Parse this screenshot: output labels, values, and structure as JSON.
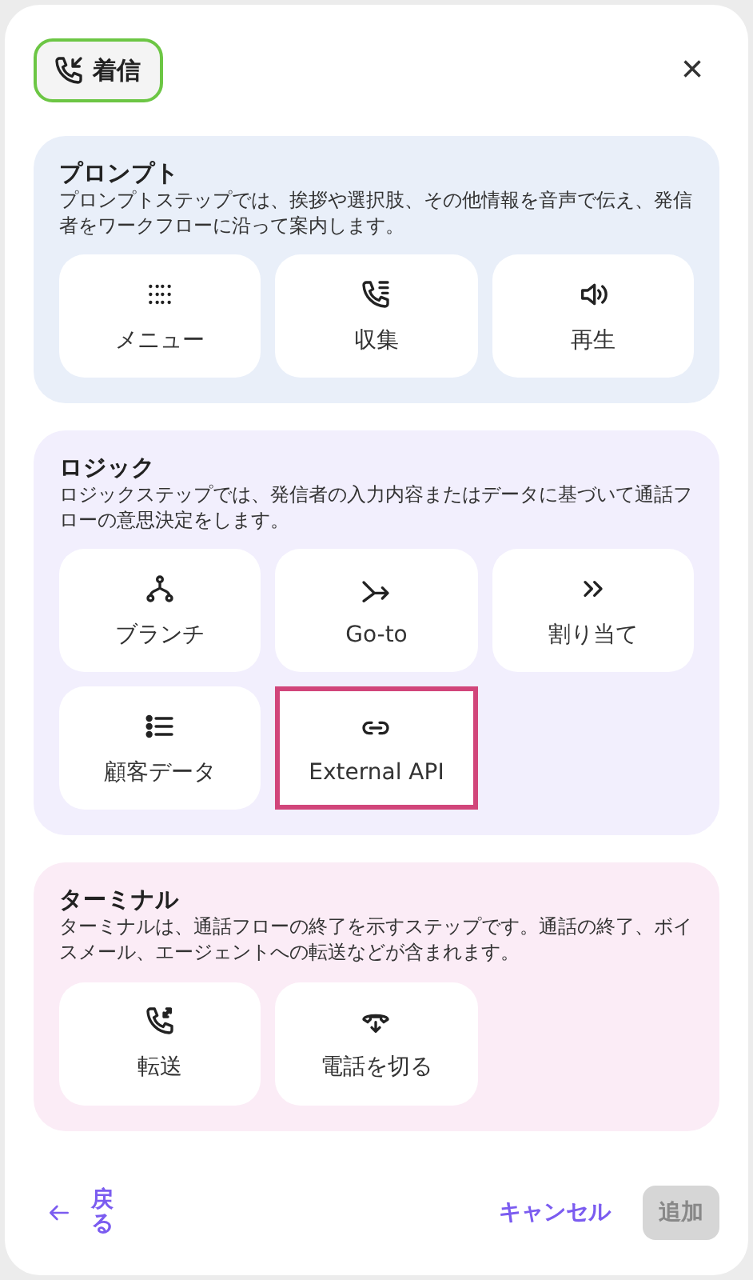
{
  "header": {
    "chip": {
      "label": "着信",
      "selected": true
    },
    "close": "×"
  },
  "sections": [
    {
      "title": "プロンプト",
      "description": "プロンプトステップでは、挨拶や選択肢、その他情報を音声で伝え、発信者をワークフローに沿って案内します。",
      "color": "#e9eff9",
      "tiles": [
        {
          "label": "メニュー",
          "selected": false
        },
        {
          "label": "収集",
          "selected": false
        },
        {
          "label": "再生",
          "selected": false
        }
      ]
    },
    {
      "title": "ロジック",
      "description": "ロジックステップでは、発信者の入力内容またはデータに基づいて通話フローの意思決定をします。",
      "color": "#f2effd",
      "tiles": [
        {
          "label": "ブランチ",
          "selected": false
        },
        {
          "label": "Go-to",
          "selected": false
        },
        {
          "label": "割り当て",
          "selected": false
        },
        {
          "label": "顧客データ",
          "selected": false
        },
        {
          "label": "External API",
          "selected": true
        }
      ]
    },
    {
      "title": "ターミナル",
      "description": "ターミナルは、通話フローの終了を示すステップです。通話の終了、ボイスメール、エージェントへの転送などが含まれます。",
      "color": "#fbecf6",
      "tiles": [
        {
          "label": "転送",
          "selected": false
        },
        {
          "label": "電話を切る",
          "selected": false
        }
      ]
    }
  ],
  "footer": {
    "back": "戻る",
    "cancel": "キャンセル",
    "add": {
      "label": "追加",
      "disabled": true
    }
  }
}
